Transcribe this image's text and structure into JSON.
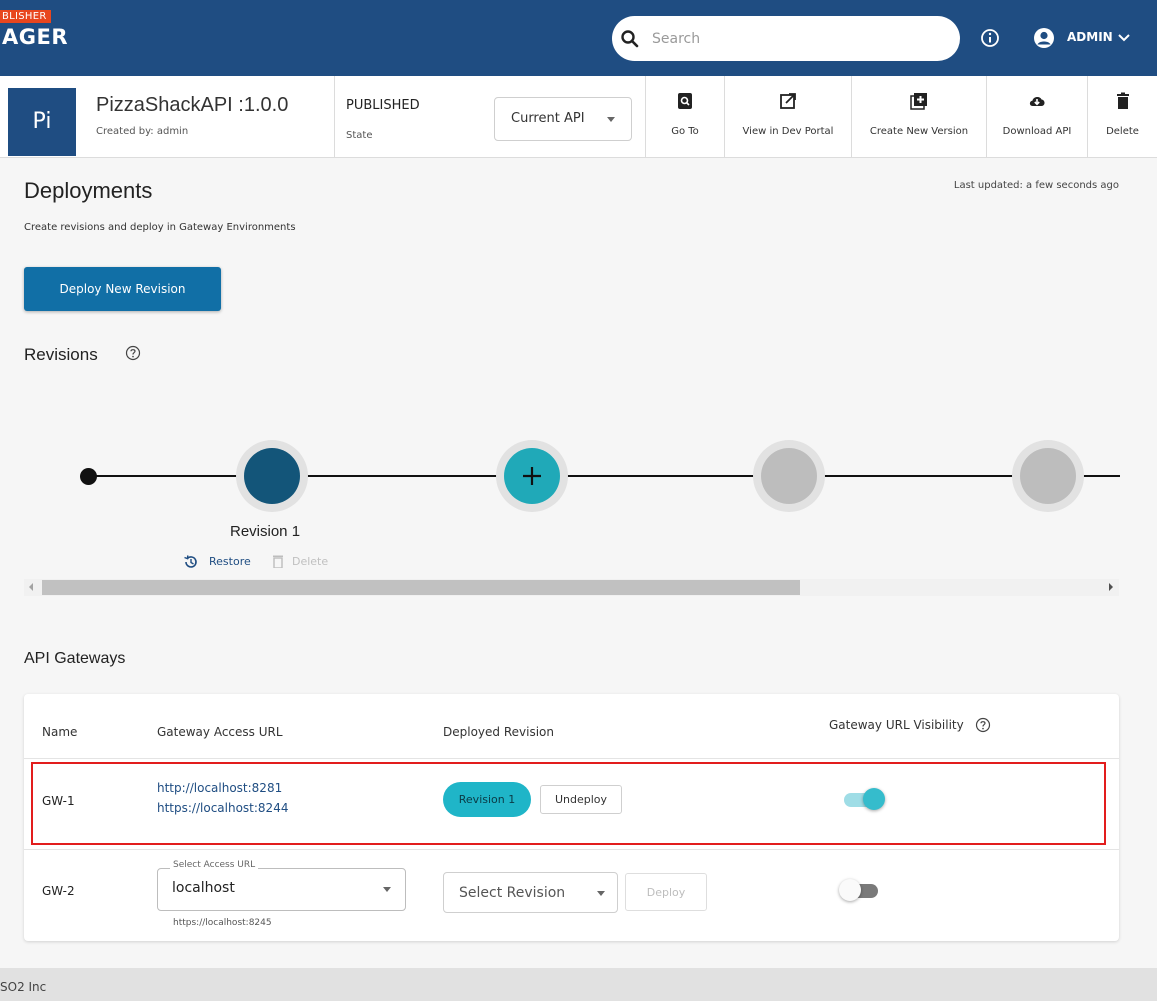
{
  "topbar": {
    "brand_small": "BLISHER",
    "brand_big": "AGER",
    "search_placeholder": "Search",
    "user_label": "ADMIN"
  },
  "api": {
    "avatar_text": "Pi",
    "name": "PizzaShackAPI :1.0.0",
    "created_by": "Created by: admin",
    "state_value": "PUBLISHED",
    "state_label": "State",
    "version_select": "Current API",
    "actions": {
      "go_to": "Go To",
      "dev_portal": "View in Dev Portal",
      "new_version": "Create New Version",
      "download": "Download API",
      "delete": "Delete"
    }
  },
  "page": {
    "title": "Deployments",
    "subtitle": "Create revisions and deploy in Gateway Environments",
    "last_updated": "Last updated: a few seconds ago",
    "deploy_button": "Deploy New Revision",
    "revisions_title": "Revisions"
  },
  "revisions": {
    "revision_label": "Revision 1",
    "restore_label": "Restore",
    "delete_label": "Delete"
  },
  "gateways": {
    "title": "API Gateways",
    "columns": {
      "name": "Name",
      "url": "Gateway Access URL",
      "revision": "Deployed Revision",
      "visibility": "Gateway URL Visibility"
    },
    "rows": [
      {
        "name": "GW-1",
        "url_http": "http://localhost:8281",
        "url_https": "https://localhost:8244",
        "revision": "Revision 1",
        "undeploy": "Undeploy",
        "visibility_on": true
      },
      {
        "name": "GW-2",
        "select_label": "Select Access URL",
        "select_value": "localhost",
        "helper": "https://localhost:8245",
        "revision_select": "Select Revision",
        "deploy": "Deploy",
        "visibility_on": false
      }
    ]
  },
  "footer": {
    "text": "SO2 Inc"
  },
  "colors": {
    "topbar": "#1f4d82",
    "primary_button": "#116fa6",
    "revision_node": "#135579",
    "add_node": "#20a9b8",
    "highlight_border": "#e21d1d"
  }
}
